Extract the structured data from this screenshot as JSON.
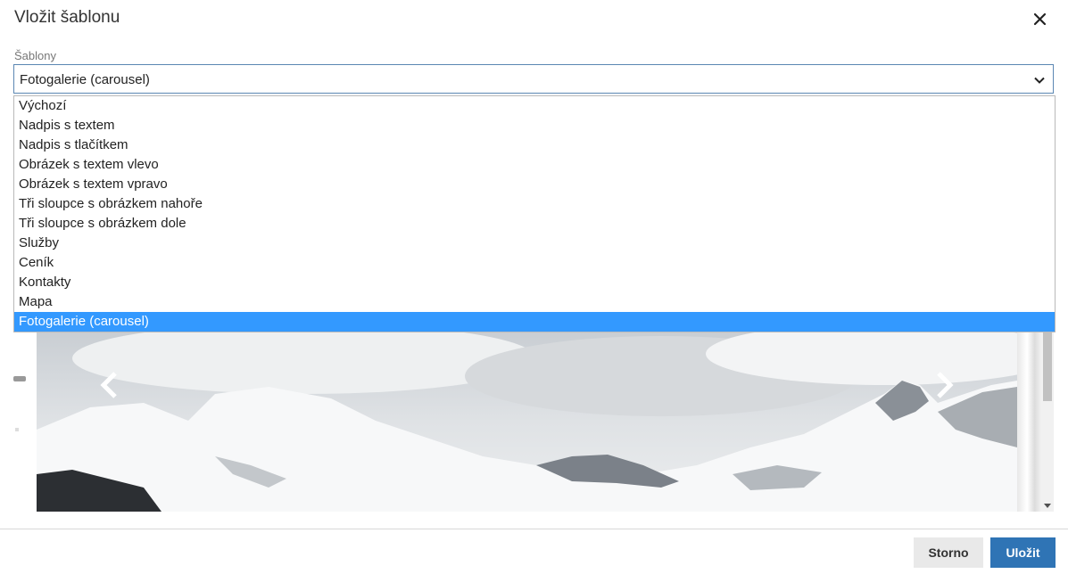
{
  "dialog": {
    "title": "Vložit šablonu"
  },
  "template_select": {
    "label": "Šablony",
    "value": "Fotogalerie (carousel)",
    "options": [
      "Výchozí",
      "Nadpis s textem",
      "Nadpis s tlačítkem",
      "Obrázek s textem vlevo",
      "Obrázek s textem vpravo",
      "Tři sloupce s obrázkem nahoře",
      "Tři sloupce s obrázkem dole",
      "Služby",
      "Ceník",
      "Kontakty",
      "Mapa",
      "Fotogalerie (carousel)"
    ],
    "selected_index": 11
  },
  "footer": {
    "cancel_label": "Storno",
    "save_label": "Uložit"
  },
  "colors": {
    "accent": "#2f74b5",
    "selection": "#3399ff"
  },
  "icons": [
    "close-icon",
    "chevron-down-icon",
    "carousel-prev-icon",
    "carousel-next-icon"
  ]
}
